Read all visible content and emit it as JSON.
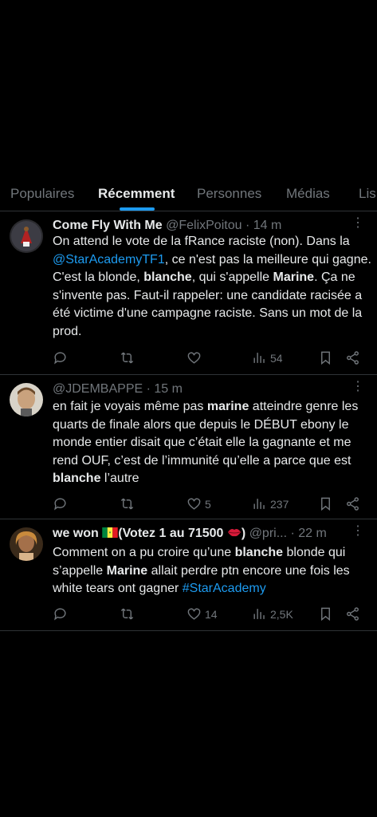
{
  "tabs": [
    {
      "label": "Populaires"
    },
    {
      "label": "Récemment"
    },
    {
      "label": "Personnes"
    },
    {
      "label": "Médias"
    },
    {
      "label": "Lis"
    }
  ],
  "tweets": [
    {
      "name": "Come Fly With Me",
      "handle": "@FelixPoitou",
      "time": "· 14 m",
      "body": {
        "p1": "On attend le vote de la fRance raciste (non). Dans la ",
        "mention": "@StarAcademyTF1",
        "p2": ", ce n'est pas la meilleure qui gagne. C'est la blonde, ",
        "b1": "blanche",
        "p3": ", qui s'appelle ",
        "b2": "Marine",
        "p4": ". Ça ne s'invente pas. Faut-il rappeler: une candidate racisée a été victime d'une campagne raciste. Sans un mot de la prod."
      },
      "stats": {
        "views": "54"
      }
    },
    {
      "name": "",
      "handle": "@JDEMBAPPE",
      "time": "· 15 m",
      "body": {
        "p1": "en fait je voyais même pas ",
        "b1": "marine",
        "p2": " atteindre genre les quarts de finale alors que depuis le DÉBUT ebony le monde entier disait que c’était elle la gagnante et me rend OUF, c’est de l’immunité qu’elle a parce que est ",
        "b2": "blanche",
        "p3": " l’autre"
      },
      "stats": {
        "likes": "5",
        "views": "237"
      }
    },
    {
      "name": "we won",
      "name_suffix": "(Votez 1 au 71500",
      "name_end": ")",
      "handle": "@pri...",
      "time": "· 22 m",
      "body": {
        "p1": "Comment on a pu croire qu’une ",
        "b1": "blanche",
        "p2": " blonde qui s’appelle ",
        "b2": "Marine",
        "p3": " allait perdre ptn encore une fois les white tears ont gagner ",
        "hashtag": "#StarAcademy"
      },
      "stats": {
        "likes": "14",
        "views": "2,5K"
      }
    }
  ],
  "colors": {
    "background": "#000000",
    "text": "#e7e9ea",
    "muted": "#71767b",
    "accent": "#1d9bf0",
    "divider": "#2f3336"
  },
  "icons": [
    "reply-icon",
    "retweet-icon",
    "like-icon",
    "views-icon",
    "bookmark-icon",
    "share-icon",
    "more-icon",
    "senegal-flag-icon",
    "lips-icon"
  ]
}
